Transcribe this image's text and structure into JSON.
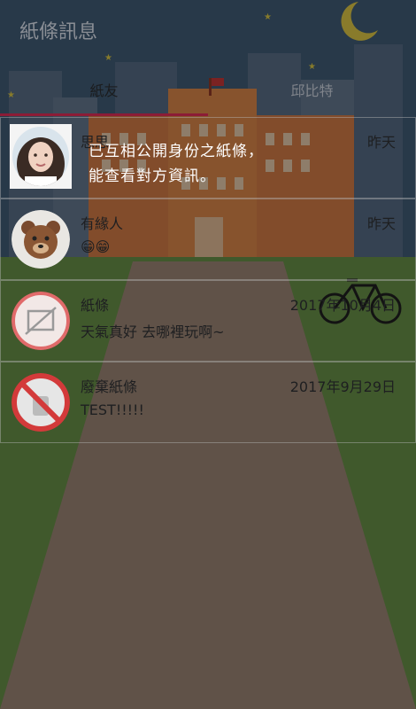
{
  "app": {
    "title": "紙條訊息"
  },
  "tabs": [
    {
      "label": "紙友"
    },
    {
      "label": "邱比特"
    }
  ],
  "rows": [
    {
      "name": "思思",
      "date": "昨天",
      "message": "",
      "avatar": "photo-girl"
    },
    {
      "name": "有緣人",
      "date": "昨天",
      "message": "😁😁",
      "avatar": "bear-icon"
    },
    {
      "name": "紙條",
      "date": "2017年10月4日",
      "message": "天氣真好 去哪裡玩啊~",
      "avatar": "image-placeholder-icon"
    },
    {
      "name": "廢棄紙條",
      "date": "2017年9月29日",
      "message": "TEST!!!!!",
      "avatar": "prohibited-icon"
    }
  ],
  "tutorial": {
    "line1": "已互相公開身份之紙條，",
    "line2": "能查看對方資訊。"
  },
  "colors": {
    "tab_indicator": "#8c1c36",
    "overlay": "rgba(0,0,0,0.42)",
    "building": "#e0844b"
  }
}
